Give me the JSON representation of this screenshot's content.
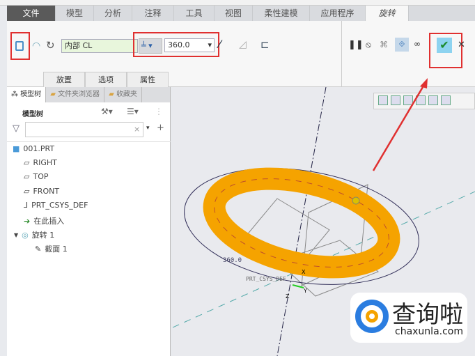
{
  "tabs": [
    "文件",
    "模型",
    "分析",
    "注释",
    "工具",
    "视图",
    "柔性建模",
    "应用程序",
    "旋转"
  ],
  "ribbon": {
    "axis_field": "内部 CL",
    "angle_value": "360.0",
    "subtabs": [
      "放置",
      "选项",
      "属性"
    ],
    "accent": "#e03030"
  },
  "panel": {
    "tabs": [
      "模型树",
      "文件夹浏览器",
      "收藏夹"
    ],
    "title": "模型树",
    "search_placeholder": "",
    "tree": [
      "001.PRT",
      "RIGHT",
      "TOP",
      "FRONT",
      "PRT_CSYS_DEF",
      "在此插入",
      "旋转 1",
      "截面 1"
    ]
  },
  "viewport": {
    "dim_label": "360.0",
    "csys_label": "PRT_CSYS_DEF",
    "axis_labels": [
      "X",
      "Y",
      "Z"
    ],
    "torus_color": "#f5a300"
  },
  "watermark": {
    "brand": "查询啦",
    "url": "chaxunla.com"
  }
}
